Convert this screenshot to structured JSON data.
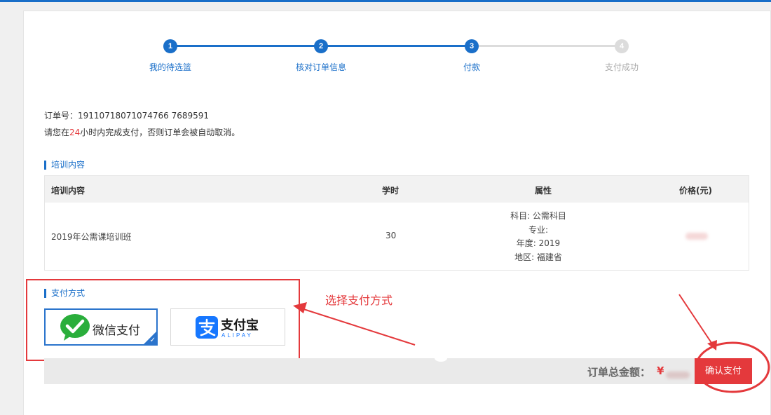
{
  "steps": [
    {
      "num": "1",
      "label": "我的待选篮",
      "state": "done"
    },
    {
      "num": "2",
      "label": "核对订单信息",
      "state": "done"
    },
    {
      "num": "3",
      "label": "付款",
      "state": "current"
    },
    {
      "num": "4",
      "label": "支付成功",
      "state": "pending"
    }
  ],
  "order": {
    "number_label": "订单号：",
    "number": "19110718071074766 7689591",
    "notice_prefix": "请您在",
    "notice_hours": "24",
    "notice_suffix": "小时内完成支付，否则订单会被自动取消。"
  },
  "training": {
    "title": "培训内容",
    "headers": [
      "培训内容",
      "学时",
      "属性",
      "价格(元)"
    ],
    "row": {
      "name": "2019年公需课培训班",
      "hours": "30",
      "attrs": [
        "科目: 公需科目",
        "专业:",
        "年度: 2019",
        "地区: 福建省"
      ]
    }
  },
  "payment": {
    "title": "支付方式",
    "wechat_label": "微信支付",
    "alipay_label": "支付宝",
    "alipay_sub": "ALIPAY",
    "annotation": "选择支付方式"
  },
  "total": {
    "label": "订单总金额：",
    "currency": "¥",
    "confirm_label": "确认支付"
  },
  "colors": {
    "accent": "#1a6fc9",
    "danger": "#e4393c",
    "wechat": "#2aae3b",
    "alipay": "#1677ff"
  }
}
